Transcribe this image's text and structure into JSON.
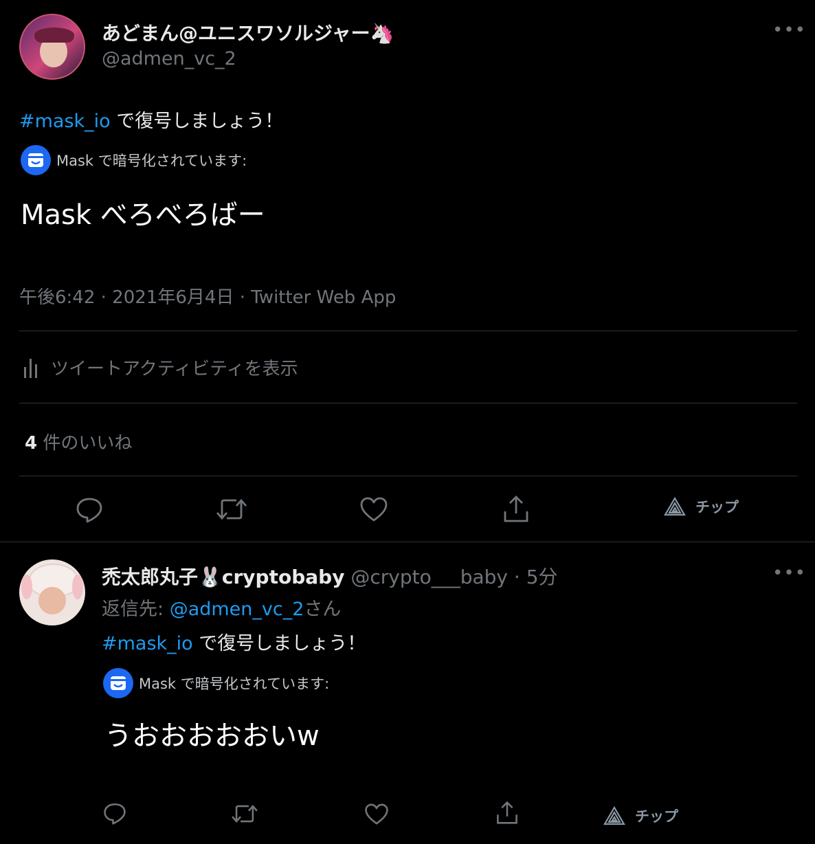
{
  "tweet": {
    "display_name": "あどまん@ユニスワソルジャー",
    "name_emoji": "🦄",
    "handle": "@admen_vc_2",
    "hashtag": "#mask_io",
    "text_after_hashtag": " で復号しましょう！",
    "mask_notice": "Mask で暗号化されています:",
    "decrypted": "Mask べろべろばー",
    "timestamp": "午後6:42 · 2021年6月4日 · Twitter Web App",
    "activity_label": "ツイートアクティビティを表示",
    "likes_count": "4",
    "likes_label": " 件のいいね",
    "tip_label": "チップ"
  },
  "reply": {
    "display_name": "禿太郎丸子",
    "name_emoji": "🐰",
    "name_suffix": "cryptobaby",
    "handle": "@crypto___baby",
    "time": " · 5分",
    "reply_to_label": "返信先: ",
    "reply_to_handle": "@admen_vc_2",
    "reply_to_suffix": "さん",
    "hashtag": "#mask_io",
    "text_after_hashtag": " で復号しましょう！",
    "mask_notice": "Mask で暗号化されています:",
    "decrypted": "うおおおおおいw",
    "tip_label": "チップ"
  },
  "colors": {
    "background": "#000000",
    "link": "#1d9bf0",
    "muted": "#71767b",
    "mask_blue": "#1c68f3"
  },
  "icons": [
    "more-icon",
    "mask-logo-icon",
    "analytics-icon",
    "reply-icon",
    "retweet-icon",
    "like-icon",
    "share-icon",
    "tip-icon"
  ]
}
